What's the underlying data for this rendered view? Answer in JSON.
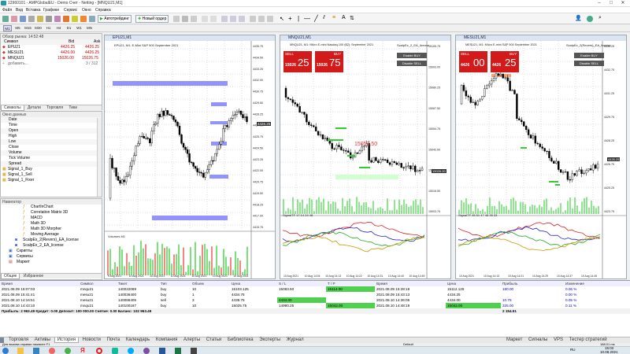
{
  "window": {
    "title": "12960101 - AMPGlobalEU - Demo Счет - Netting - [MNQU21,M1]"
  },
  "menu": [
    "Файл",
    "Вид",
    "Вставка",
    "Графики",
    "Сервис",
    "Окно",
    "Справка"
  ],
  "toolbar": {
    "algo": "Автотрейдинг",
    "new_order": "Новый ордер"
  },
  "timeframes": [
    "M1",
    "M5",
    "M15",
    "M30",
    "H1",
    "H4",
    "D1",
    "W1",
    "MN"
  ],
  "market_watch": {
    "title": "Обзор рынка: 14:52:48",
    "cols": [
      "Символ",
      "Bid",
      "Ask"
    ],
    "rows": [
      {
        "sym": "EPU21",
        "bid": "4426.25",
        "ask": "4426.25"
      },
      {
        "sym": "MESU21",
        "bid": "4426.00",
        "ask": "4426.25"
      },
      {
        "sym": "MNQU21",
        "bid": "15026.00",
        "ask": "15026.75"
      }
    ],
    "add": "добавить...",
    "count": "3 / 312",
    "tabs": [
      "Символы",
      "Детали",
      "Торговля",
      "Тики"
    ]
  },
  "data_window": {
    "title": "Окно данных",
    "rows": [
      "Date",
      "Time",
      "Open",
      "High",
      "Low",
      "Close",
      "Volume",
      "Tick Volume",
      "Spread"
    ],
    "signals": [
      "Signal_1_Buy",
      "Signal_1_Sell",
      "Signal_1_Fixer"
    ]
  },
  "navigator": {
    "title": "Навигатор",
    "items": [
      "ChartInChart",
      "Correlation Matrix 3D",
      "MACD",
      "Math 3D",
      "Math 3D Morpher",
      "Moving Average",
      "ScalpEx_2(Revers)_EA_license",
      "ScalpEx_2_EA_license",
      "Скрипты",
      "Сервисы",
      "Маркет"
    ],
    "tabs": [
      "Общие",
      "Избранное"
    ]
  },
  "charts": [
    {
      "title": "EPU21,M1",
      "info": "EPU21, M1: E-Mini S&P 500 September 2021",
      "price": "4426.25",
      "scale": [
        "4435.75",
        "4434.50",
        "4433.25",
        "4432.00",
        "4430.75",
        "4429.50",
        "4428.25",
        "4427.00",
        "4425.75",
        "4424.50",
        "4423.25",
        "4422.00",
        "4420.75",
        "4419.50",
        "4418.25",
        "4417.00",
        "4415.75"
      ],
      "volume_label": "Volumes M1",
      "dates": [
        "9 Aug 2021",
        "10 Aug 2021",
        "10 Aug 2021",
        "10 Aug 2021",
        "10 Aug 2021",
        "10 Aug 2021",
        "10 Aug 2021"
      ]
    },
    {
      "title": "MNQU21,M1",
      "info": "MNQU21, M1: Micro E-mini Nasdaq-100 ($2): September 2021",
      "sell": "SELL",
      "buy": "BUY",
      "sell_big": "25",
      "buy_big": "75",
      "sell_small": "15026",
      "buy_small": "15026",
      "ea": "ScalpEx_2_EA_license",
      "buttons": [
        "Enable BUY",
        "Disable SELL"
      ],
      "price": "15026.00",
      "level": "15053.50",
      "osc_label": "SignalTF 17 14 24 48",
      "scale": [
        "15105.75",
        "15093.00",
        "15080.25",
        "15067.50",
        "15054.75",
        "15042.00",
        "15029.25",
        "15016.50",
        "15003.75"
      ],
      "dates": [
        "10 Aug 2021",
        "10 Aug 14:04",
        "10 Aug 14:13",
        "10 Aug 14:22",
        "10 Aug 14:31",
        "10 Aug 14:40",
        "10 Aug 14:49"
      ]
    },
    {
      "title": "MESU21,M1",
      "info": "MESU21, M1: Micro E-mini S&P 500 September 2021",
      "sell": "SELL",
      "buy": "BUY",
      "sell_big": "00",
      "buy_big": "25",
      "sell_small": "4426",
      "buy_small": "4426",
      "ea": "ScalpEx_2(Revers)_EA_license",
      "buttons": [
        "Enable BUY",
        "Disable SELL"
      ],
      "price": "4426.25",
      "osc_label": "SignalTF 45 51 47 48 35 33",
      "scale": [
        "4434.25",
        "4432.75",
        "4431.25",
        "4429.75",
        "4428.25",
        "4426.75",
        "4425.25",
        "4423.75"
      ],
      "dates": [
        "10 Aug 2021",
        "10 Aug 14:13",
        "10 Aug 14:21",
        "10 Aug 14:29",
        "10 Aug 14:37",
        "10 Aug 14:45"
      ]
    }
  ],
  "terminal": {
    "cols": [
      "Время",
      "Символ",
      "Тикет",
      "Тип",
      "Объем",
      "Цена",
      "S / L",
      "T / P",
      "Время",
      "Цена",
      "Прибыль",
      "Изменение"
    ],
    "rows": [
      [
        "2021.08.09 15:07:03",
        "mnqu21",
        "140022089",
        "buy",
        "10",
        "15103.125",
        "15083.50",
        "15114.00",
        "2021.08.09 15:28:18",
        "15112.125",
        "180.00",
        "0.06 %"
      ],
      [
        "2021.08.09 15:41:41",
        "mesu21",
        "140036400",
        "buy",
        "1",
        "4434.75",
        "",
        "",
        "2021.08.09 15:43:13",
        "4434.25",
        "",
        "0.00 %"
      ],
      [
        "2021.08.10 14:16:51",
        "mesu21",
        "140086405",
        "sell",
        "3",
        "4438.75",
        "4434.00",
        "",
        "2021.08.10 14:36:06",
        "4434.00",
        "10.75",
        "0.05 %"
      ],
      [
        "2021.08.10 14:43:10",
        "mnqu21",
        "140100187",
        "buy",
        "10",
        "15025.75",
        "14990.25",
        "15042.00",
        "2021.08.10 14:48:19",
        "15042.00",
        "325.00",
        "0.11 %"
      ]
    ],
    "summary": "Прибыль: 2 963.49  Кредит: 0.00  Депозит: 100 000.00  Снятие: 0.00  Баланс: 102 963.49",
    "summary_profit": "2 154.51",
    "tabs": [
      "Торговля",
      "Активы",
      "История",
      "Новости",
      "Почта",
      "Календарь",
      "Компания",
      "Алерты",
      "Статьи",
      "Библиотека",
      "Эксперты",
      "Журнал"
    ],
    "right_tabs": [
      "Маркет",
      "Сигналы",
      "VPS",
      "Тестер стратегий"
    ]
  },
  "status": {
    "help": "Для вызова справки нажмите F1",
    "profile": "Default",
    "net": "188.01 ms"
  },
  "taskbar": {
    "lang": "RU",
    "time": "15:02",
    "date": "10.08.2021"
  },
  "colors": {
    "bull": "#000000",
    "sell": "#d21a1a",
    "buy": "#d21a1a",
    "zone": "#8080ff",
    "green": "#33cc33"
  }
}
